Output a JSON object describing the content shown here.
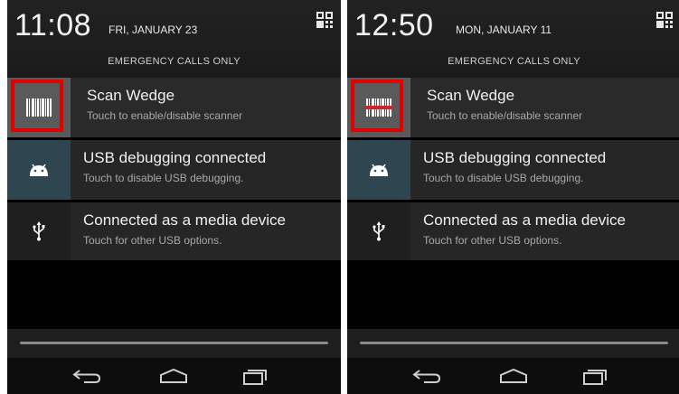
{
  "screens": [
    {
      "time": "11:08",
      "date": "FRI, JANUARY 23",
      "status": "EMERGENCY CALLS ONLY",
      "notifications": [
        {
          "title": "Scan Wedge",
          "subtitle": "Touch to enable/disable scanner",
          "icon": "barcode-icon",
          "barcode_color": "#ffffff"
        },
        {
          "title": "USB debugging connected",
          "subtitle": "Touch to disable USB debugging.",
          "icon": "android-icon"
        },
        {
          "title": "Connected as a media device",
          "subtitle": "Touch for other USB options.",
          "icon": "usb-icon"
        }
      ]
    },
    {
      "time": "12:50",
      "date": "MON, JANUARY 11",
      "status": "EMERGENCY CALLS ONLY",
      "notifications": [
        {
          "title": "Scan Wedge",
          "subtitle": "Touch to enable/disable scanner",
          "icon": "barcode-icon",
          "barcode_color": "#e31b23"
        },
        {
          "title": "USB debugging connected",
          "subtitle": "Touch to disable USB debugging.",
          "icon": "android-icon"
        },
        {
          "title": "Connected as a media device",
          "subtitle": "Touch for other USB options.",
          "icon": "usb-icon"
        }
      ]
    }
  ],
  "colors": {
    "highlight": "#e10000",
    "background": "#000000"
  },
  "nav_icons": [
    "back-icon",
    "home-icon",
    "recent-apps-icon"
  ]
}
